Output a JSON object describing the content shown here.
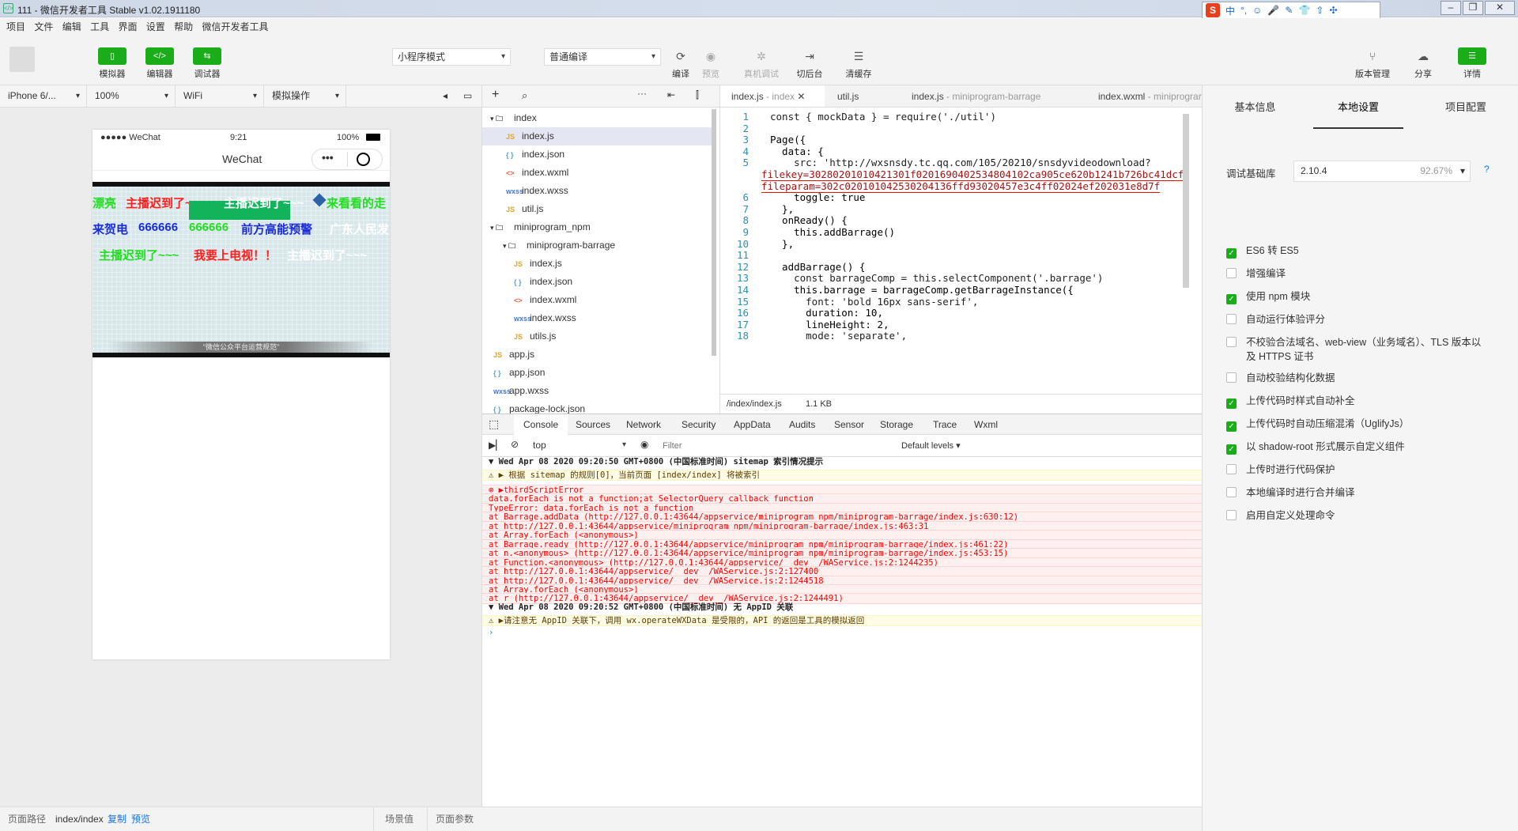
{
  "window": {
    "title": "111 - 微信开发者工具 Stable v1.02.1911180",
    "ime": [
      "中",
      "°,",
      "☺",
      "🎤",
      "✎",
      "👕",
      "⇧",
      "✣"
    ]
  },
  "menu": [
    "项目",
    "文件",
    "编辑",
    "工具",
    "界面",
    "设置",
    "帮助",
    "微信开发者工具"
  ],
  "toolbar": {
    "simulator": "模拟器",
    "editor": "编辑器",
    "debugger": "调试器",
    "mode": "小程序模式",
    "compile_mode": "普通编译",
    "compile": "编译",
    "preview": "预览",
    "remote_debug": "真机调试",
    "background": "切后台",
    "clear_cache": "清缓存",
    "version": "版本管理",
    "share": "分享",
    "details": "详情"
  },
  "simbar": {
    "device": "iPhone 6/...",
    "zoom": "100%",
    "network": "WiFi",
    "sim_op": "模拟操作"
  },
  "phone": {
    "carrier": "●●●●● WeChat",
    "time": "9:21",
    "battery": "100%",
    "nav_title": "WeChat",
    "watermark": "\"微信公众平台运营规范\"",
    "barrage": [
      "漂亮",
      "主播迟到了~~~",
      "主播迟到了~~~",
      "来看看的走",
      "来贺电",
      "666666",
      "666666",
      "前方高能预警",
      "广东人民发",
      "主播迟到了~~~",
      "我要上电视！！",
      "主播迟到了~~~"
    ]
  },
  "explorer": {
    "items": [
      {
        "n": "index",
        "t": "folder",
        "d": 1
      },
      {
        "n": "index.js",
        "t": "js",
        "d": 2,
        "sel": true
      },
      {
        "n": "index.json",
        "t": "json",
        "d": 2
      },
      {
        "n": "index.wxml",
        "t": "wxml",
        "d": 2
      },
      {
        "n": "index.wxss",
        "t": "wxss",
        "d": 2
      },
      {
        "n": "util.js",
        "t": "js",
        "d": 2
      },
      {
        "n": "miniprogram_npm",
        "t": "folder",
        "d": 1
      },
      {
        "n": "miniprogram-barrage",
        "t": "folder",
        "d": 2
      },
      {
        "n": "index.js",
        "t": "js",
        "d": 3
      },
      {
        "n": "index.json",
        "t": "json",
        "d": 3
      },
      {
        "n": "index.wxml",
        "t": "wxml",
        "d": 3
      },
      {
        "n": "index.wxss",
        "t": "wxss",
        "d": 3
      },
      {
        "n": "utils.js",
        "t": "js",
        "d": 3
      },
      {
        "n": "app.js",
        "t": "js",
        "d": 1
      },
      {
        "n": "app.json",
        "t": "json",
        "d": 1
      },
      {
        "n": "app.wxss",
        "t": "wxss",
        "d": 1
      },
      {
        "n": "package-lock.json",
        "t": "json",
        "d": 1
      }
    ]
  },
  "editor": {
    "tabs": [
      {
        "name": "index.js",
        "hint": "- index",
        "active": true
      },
      {
        "name": "util.js",
        "hint": ""
      },
      {
        "name": "index.js",
        "hint": "- miniprogram-barrage"
      },
      {
        "name": "index.wxml",
        "hint": "- miniprogram-"
      }
    ],
    "lines": [
      {
        "n": "1",
        "c": "const { mockData } = require('./util')"
      },
      {
        "n": "2",
        "c": ""
      },
      {
        "n": "3",
        "c": "Page({"
      },
      {
        "n": "4",
        "c": "  data: {"
      },
      {
        "n": "5",
        "c": "    src: 'http://wxsnsdy.tc.qq.com/105/20210/snsdyvideodownload?"
      },
      {
        "n": "",
        "c": "filekey=30280201010421301f0201690402534804102ca905ce620b1241b726bc41dcf"
      },
      {
        "n": "",
        "c": "fileparam=302c020101042530204136ffd93020457e3c4ff02024ef202031e8d7f"
      },
      {
        "n": "6",
        "c": "    toggle: true"
      },
      {
        "n": "7",
        "c": "  },"
      },
      {
        "n": "8",
        "c": "  onReady() {"
      },
      {
        "n": "9",
        "c": "    this.addBarrage()"
      },
      {
        "n": "10",
        "c": "  },"
      },
      {
        "n": "11",
        "c": ""
      },
      {
        "n": "12",
        "c": "  addBarrage() {"
      },
      {
        "n": "13",
        "c": "    const barrageComp = this.selectComponent('.barrage')"
      },
      {
        "n": "14",
        "c": "    this.barrage = barrageComp.getBarrageInstance({"
      },
      {
        "n": "15",
        "c": "      font: 'bold 16px sans-serif',"
      },
      {
        "n": "16",
        "c": "      duration: 10,"
      },
      {
        "n": "17",
        "c": "      lineHeight: 2,"
      },
      {
        "n": "18",
        "c": "      mode: 'separate',"
      }
    ],
    "path": "/index/index.js",
    "size": "1.1 KB"
  },
  "debugger": {
    "tabs": [
      "Console",
      "Sources",
      "Network",
      "Security",
      "AppData",
      "Audits",
      "Sensor",
      "Storage",
      "Trace",
      "Wxml"
    ],
    "context": "top",
    "filter_placeholder": "Filter",
    "levels": "Default levels",
    "logs": [
      {
        "k": "grp",
        "t": "▼ Wed Apr 08 2020 09:20:50 GMT+0800 (中国标准时间) sitemap 索引情况提示"
      },
      {
        "k": "warn",
        "t": "  ⚠  ▶ 根据 sitemap 的规则[0]，当前页面 [index/index] 将被索引"
      },
      {
        "k": "err",
        "t": "⊗ ▶thirdScriptError"
      },
      {
        "k": "err",
        "t": "  data.forEach is not a function;at SelectorQuery callback function"
      },
      {
        "k": "err",
        "t": "  TypeError: data.forEach is not a function"
      },
      {
        "k": "err",
        "t": "      at Barrage.addData (http://127.0.0.1:43644/appservice/miniprogram_npm/miniprogram-barrage/index.js:630:12)"
      },
      {
        "k": "err",
        "t": "      at http://127.0.0.1:43644/appservice/miniprogram_npm/miniprogram-barrage/index.js:463:31"
      },
      {
        "k": "err",
        "t": "      at Array.forEach (<anonymous>)"
      },
      {
        "k": "err",
        "t": "      at Barrage.ready (http://127.0.0.1:43644/appservice/miniprogram_npm/miniprogram-barrage/index.js:461:22)"
      },
      {
        "k": "err",
        "t": "      at n.<anonymous> (http://127.0.0.1:43644/appservice/miniprogram_npm/miniprogram-barrage/index.js:453:15)"
      },
      {
        "k": "err",
        "t": "      at Function.<anonymous> (http://127.0.0.1:43644/appservice/__dev__/WAService.js:2:1244235)"
      },
      {
        "k": "err",
        "t": "      at http://127.0.0.1:43644/appservice/__dev__/WAService.js:2:127400"
      },
      {
        "k": "err",
        "t": "      at http://127.0.0.1:43644/appservice/__dev__/WAService.js:2:1244518"
      },
      {
        "k": "err",
        "t": "      at Array.forEach (<anonymous>)"
      },
      {
        "k": "err",
        "t": "      at r (http://127.0.0.1:43644/appservice/__dev__/WAService.js:2:1244491)"
      },
      {
        "k": "grp",
        "t": "▼ Wed Apr 08 2020 09:20:52 GMT+0800 (中国标准时间) 无 AppID 关联"
      },
      {
        "k": "warn",
        "t": "  ⚠  ▶请注意无 AppID 关联下，调用 wx.operateWXData 是受限的，API 的返回是工具的模拟返回"
      },
      {
        "k": "prompt",
        "t": "  ›"
      }
    ]
  },
  "rpanel": {
    "tabs": [
      "基本信息",
      "本地设置",
      "项目配置"
    ],
    "lib_label": "调试基础库",
    "lib_version": "2.10.4",
    "lib_pct": "92.67%",
    "help": "?",
    "options": [
      {
        "l": "ES6 转 ES5",
        "on": true
      },
      {
        "l": "增强编译",
        "on": false
      },
      {
        "l": "使用 npm 模块",
        "on": true
      },
      {
        "l": "自动运行体验评分",
        "on": false
      },
      {
        "l": "不校验合法域名、web-view（业务域名）、TLS 版本以及 HTTPS 证书",
        "on": false
      },
      {
        "l": "自动校验结构化数据",
        "on": false
      },
      {
        "l": "上传代码时样式自动补全",
        "on": true
      },
      {
        "l": "上传代码时自动压缩混淆（UglifyJs）",
        "on": true
      },
      {
        "l": "以 shadow-root 形式展示自定义组件",
        "on": true
      },
      {
        "l": "上传时进行代码保护",
        "on": false
      },
      {
        "l": "本地编译时进行合并编译",
        "on": false
      },
      {
        "l": "启用自定义处理命令",
        "on": false
      }
    ]
  },
  "bottom": {
    "path_label": "页面路径",
    "path": "index/index",
    "copy": "复制",
    "preview": "预览",
    "scene": "场景值",
    "params": "页面参数"
  },
  "colors": {
    "green": "#1aad19",
    "barrage_red": "#ff1f1f",
    "barrage_green": "#22dd22",
    "barrage_blue": "#1a2bd8",
    "barrage_white": "#ffffff"
  }
}
